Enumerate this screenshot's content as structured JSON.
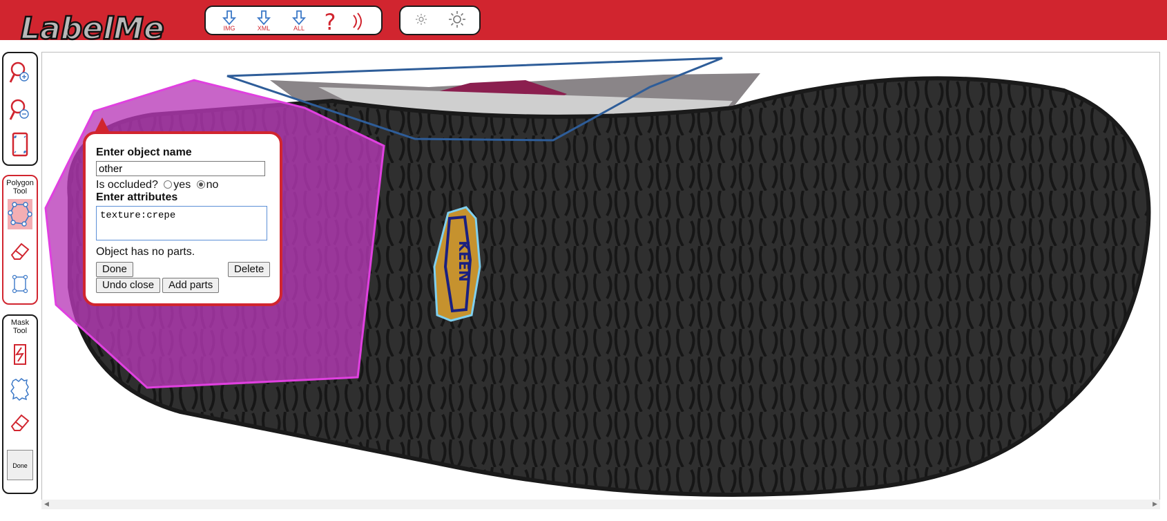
{
  "logo": {
    "text": "LabelMe"
  },
  "toolbar": {
    "buttons": [
      {
        "icon": "download-arrow-icon",
        "label": "IMG"
      },
      {
        "icon": "download-arrow-icon",
        "label": "XML"
      },
      {
        "icon": "download-arrow-icon",
        "label": "ALL"
      },
      {
        "icon": "help-question-icon",
        "label": ""
      },
      {
        "icon": "signal-waves-icon",
        "label": ""
      }
    ],
    "brightness": [
      {
        "icon": "brightness-down-icon"
      },
      {
        "icon": "brightness-up-icon"
      }
    ]
  },
  "sidebar": {
    "zoom_tools": [
      "zoom-in-icon",
      "zoom-out-icon",
      "fit-screen-icon"
    ],
    "polygon_tool": {
      "title": "Polygon Tool",
      "tools": [
        "polygon-icon",
        "eraser-icon",
        "bounding-box-icon"
      ]
    },
    "mask_tool": {
      "title": "Mask Tool",
      "tools": [
        "scribble-icon",
        "mask-region-icon",
        "eraser-icon"
      ],
      "done_label": "Done"
    }
  },
  "dialog": {
    "name_heading": "Enter object name",
    "name_value": "other",
    "occluded_label": "Is occluded?",
    "occluded_options": [
      "yes",
      "no"
    ],
    "occluded_selected": "no",
    "attributes_heading": "Enter attributes",
    "attributes_value": "texture:crepe",
    "parts_text": "Object has no parts.",
    "buttons": {
      "done": "Done",
      "delete": "Delete",
      "undo_close": "Undo close",
      "add_parts": "Add parts"
    }
  },
  "image": {
    "subject": "shoe sole",
    "brand_badge": "KEEN",
    "annotation_colors": {
      "selected_polygon": "#cc33cc",
      "upper_polygon": "#2e5d99",
      "logo_outer": "#7fd0f0",
      "logo_inner": "#1a2080"
    }
  },
  "colors": {
    "accent": "#d1252f",
    "active_tool": "#f3aeb3"
  }
}
